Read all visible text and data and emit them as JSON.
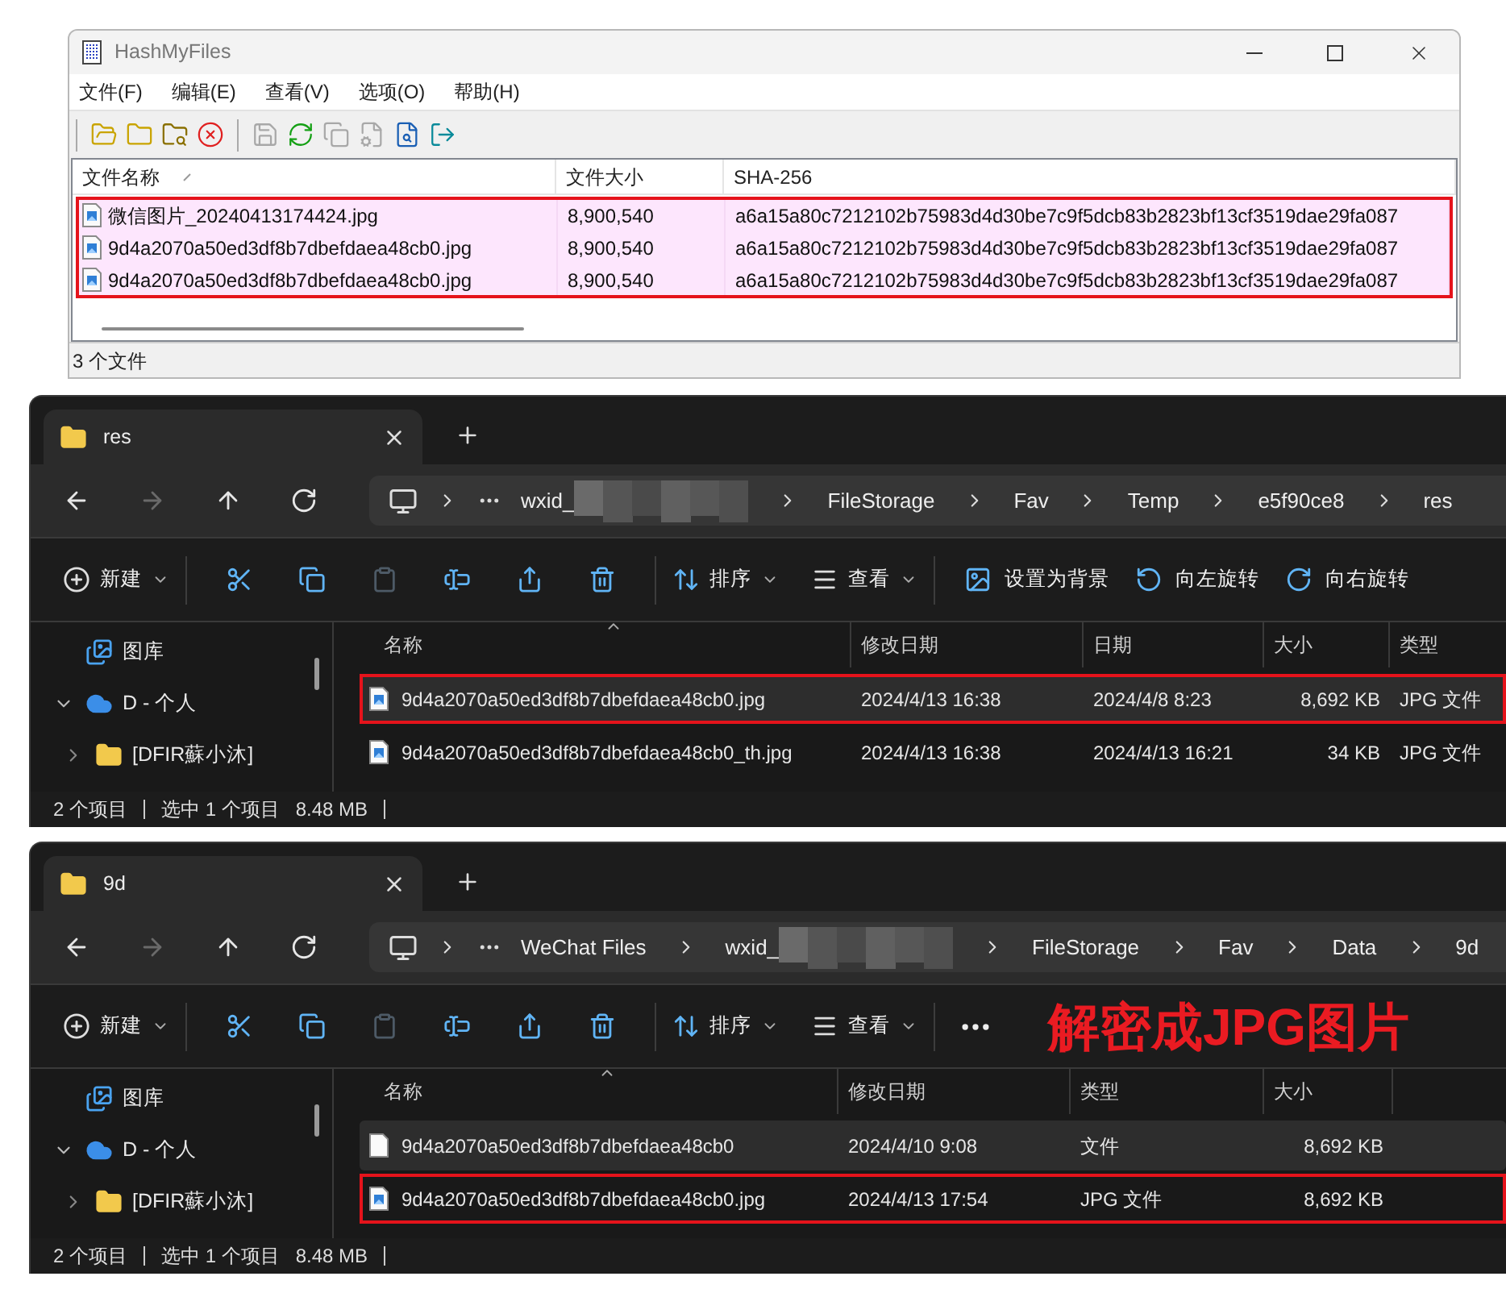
{
  "hashmyfiles": {
    "title": "HashMyFiles",
    "menu": [
      "文件(F)",
      "编辑(E)",
      "查看(V)",
      "选项(O)",
      "帮助(H)"
    ],
    "toolbar": [
      {
        "disabled": false
      },
      {
        "disabled": false
      },
      {
        "disabled": false
      },
      {
        "disabled": false
      },
      {
        "disabled": true
      },
      {
        "disabled": false
      },
      {
        "disabled": true
      },
      {
        "disabled": true
      },
      {
        "disabled": false
      },
      {
        "disabled": false
      }
    ],
    "columns": [
      {
        "label": "文件名称",
        "sorted": true
      },
      {
        "label": "文件大小",
        "sorted": false
      },
      {
        "label": "SHA-256",
        "sorted": false
      }
    ],
    "rows": [
      {
        "cells": [
          "微信图片_20240413174424.jpg",
          "8,900,540",
          "a6a15a80c7212102b75983d4d30be7c9f5dcb83b2823bf13cf3519dae29fa087"
        ],
        "color": "#fde6fd",
        "boxed": true
      },
      {
        "cells": [
          "9d4a2070a50ed3df8b7dbefdaea48cb0.jpg",
          "8,900,540",
          "a6a15a80c7212102b75983d4d30be7c9f5dcb83b2823bf13cf3519dae29fa087"
        ],
        "color": "#fde6fd",
        "boxed": true
      },
      {
        "cells": [
          "9d4a2070a50ed3df8b7dbefdaea48cb0.jpg",
          "8,900,540",
          "a6a15a80c7212102b75983d4d30be7c9f5dcb83b2823bf13cf3519dae29fa087"
        ],
        "color": "#fde6fd",
        "boxed": true
      }
    ],
    "status": "3 个文件"
  },
  "explorers": [
    {
      "tab": "res",
      "nav": [
        {
          "disabled": false
        },
        {
          "disabled": true
        },
        {
          "disabled": false
        },
        {
          "disabled": false
        }
      ],
      "breadcrumbs": [
        {
          "label": "wxid_",
          "redacted": true
        },
        {
          "label": "FileStorage",
          "redacted": false
        },
        {
          "label": "Fav",
          "redacted": false
        },
        {
          "label": "Temp",
          "redacted": false
        },
        {
          "label": "e5f90ce8",
          "redacted": false
        },
        {
          "label": "res",
          "redacted": false
        }
      ],
      "new": "新建",
      "icon_buttons": [
        {
          "disabled": false
        },
        {
          "disabled": false
        },
        {
          "disabled": true
        },
        {
          "disabled": false
        },
        {
          "disabled": false
        },
        {
          "disabled": false
        }
      ],
      "sort": "排序",
      "view": "查看",
      "extras": [
        {
          "label": "设置为背景"
        },
        {
          "label": "向左旋转"
        },
        {
          "label": "向右旋转"
        }
      ],
      "more": false,
      "sidebar": [
        {
          "label": "图库",
          "kind": "library"
        },
        {
          "label": "D - 个人",
          "kind": "cloud",
          "expanded": true,
          "children": [
            {
              "label": "[DFIR蘇小沐]",
              "kind": "folder",
              "expanded": false
            }
          ]
        }
      ],
      "columns": [
        {
          "label": "名称",
          "kind": "text",
          "sorted": true
        },
        {
          "label": "修改日期",
          "kind": "text",
          "sorted": false
        },
        {
          "label": "日期",
          "kind": "text",
          "sorted": false
        },
        {
          "label": "大小",
          "kind": "size",
          "sorted": false
        },
        {
          "label": "类型",
          "kind": "text",
          "sorted": false
        }
      ],
      "rows": [
        {
          "kind": "image",
          "cells": [
            "9d4a2070a50ed3df8b7dbefdaea48cb0.jpg",
            "2024/4/13 16:38",
            "2024/4/8 8:23",
            "8,692 KB",
            "JPG 文件"
          ],
          "selected": true,
          "boxed": true
        },
        {
          "kind": "image",
          "cells": [
            "9d4a2070a50ed3df8b7dbefdaea48cb0_th.jpg",
            "2024/4/13 16:38",
            "2024/4/13 16:21",
            "34 KB",
            "JPG 文件"
          ],
          "selected": false,
          "boxed": false
        }
      ],
      "status": {
        "count": "2 个项目",
        "selection": "选中 1 个项目",
        "size": "8.48 MB"
      }
    },
    {
      "tab": "9d",
      "nav": [
        {
          "disabled": false
        },
        {
          "disabled": true
        },
        {
          "disabled": false
        },
        {
          "disabled": false
        }
      ],
      "breadcrumbs": [
        {
          "label": "WeChat Files",
          "redacted": false
        },
        {
          "label": "wxid_",
          "redacted": true
        },
        {
          "label": "FileStorage",
          "redacted": false
        },
        {
          "label": "Fav",
          "redacted": false
        },
        {
          "label": "Data",
          "redacted": false
        },
        {
          "label": "9d",
          "redacted": false
        }
      ],
      "new": "新建",
      "icon_buttons": [
        {
          "disabled": false
        },
        {
          "disabled": false
        },
        {
          "disabled": true
        },
        {
          "disabled": false
        },
        {
          "disabled": false
        },
        {
          "disabled": false
        }
      ],
      "sort": "排序",
      "view": "查看",
      "more": true,
      "annotation": "解密成JPG图片",
      "sidebar": [
        {
          "label": "图库",
          "kind": "library"
        },
        {
          "label": "D - 个人",
          "kind": "cloud",
          "expanded": true,
          "children": [
            {
              "label": "[DFIR蘇小沐]",
              "kind": "folder",
              "expanded": false
            }
          ]
        }
      ],
      "columns": [
        {
          "label": "名称",
          "kind": "text",
          "sorted": true
        },
        {
          "label": "修改日期",
          "kind": "text",
          "sorted": false
        },
        {
          "label": "类型",
          "kind": "text",
          "sorted": false
        },
        {
          "label": "大小",
          "kind": "size",
          "sorted": false
        }
      ],
      "rows": [
        {
          "kind": "file",
          "cells": [
            "9d4a2070a50ed3df8b7dbefdaea48cb0",
            "2024/4/10 9:08",
            "文件",
            "8,692 KB"
          ],
          "selected": true,
          "boxed": false
        },
        {
          "kind": "image",
          "cells": [
            "9d4a2070a50ed3df8b7dbefdaea48cb0.jpg",
            "2024/4/13 17:54",
            "JPG 文件",
            "8,692 KB"
          ],
          "selected": false,
          "boxed": true
        }
      ],
      "status": {
        "count": "2 个项目",
        "selection": "选中 1 个项目",
        "size": "8.48 MB"
      }
    }
  ]
}
